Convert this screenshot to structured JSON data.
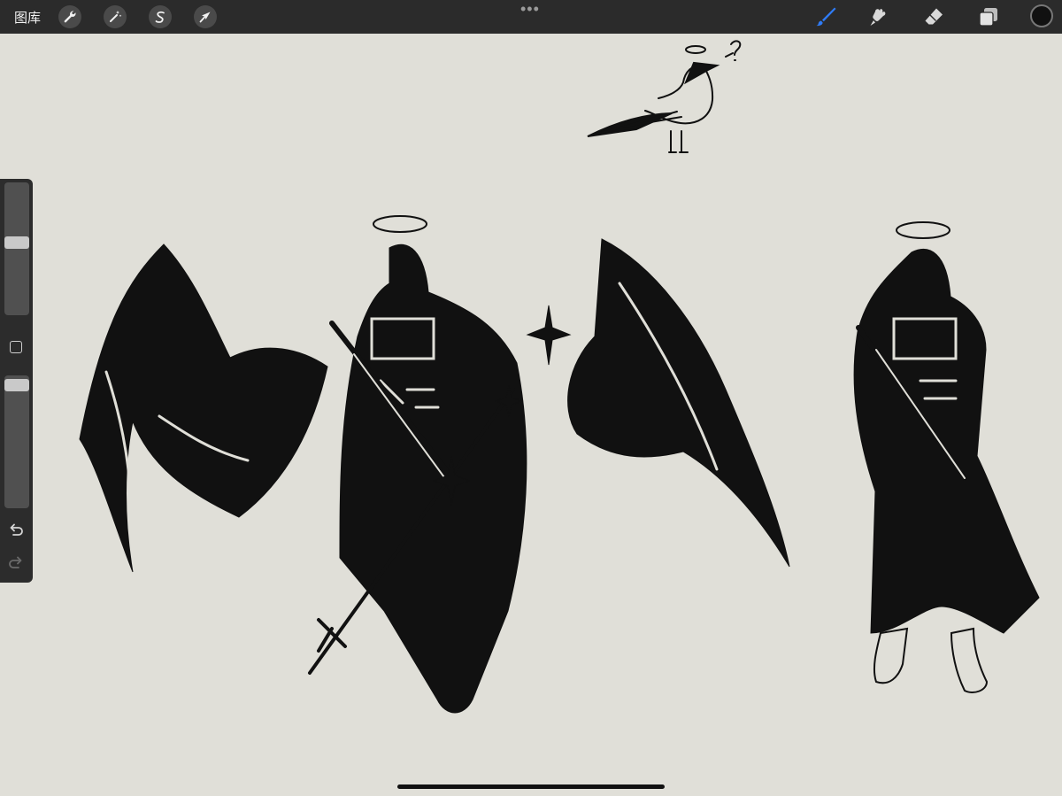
{
  "topbar": {
    "gallery_label": "图库",
    "actions": [
      "wrench-icon",
      "magic-wand-icon",
      "selection-s-icon",
      "transform-arrow-icon"
    ],
    "more_glyph": "•••",
    "tools": [
      "brush-icon",
      "smudge-icon",
      "eraser-icon",
      "layers-icon"
    ],
    "active_tool": "brush-icon",
    "active_tool_color": "#2f7bf5",
    "current_color": "#111111"
  },
  "sidebar": {
    "brush_size_level": 0.55,
    "opacity_level": 0.97,
    "buttons": [
      "modify-square-icon",
      "undo-icon",
      "redo-icon"
    ]
  },
  "canvas": {
    "background": "#e0dfd8",
    "ink": "#111111"
  }
}
